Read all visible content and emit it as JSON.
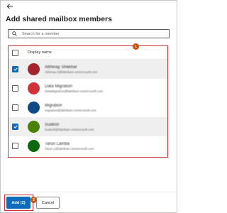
{
  "dialog": {
    "title": "Add shared mailbox members"
  },
  "search": {
    "placeholder": "Search for a member",
    "value": ""
  },
  "list": {
    "header_label": "Display name",
    "members": [
      {
        "name": "Abhinay Shekhar",
        "email": "Abhinay.S@fabrikam.onmicrosoft.com",
        "selected": true,
        "avatar_color": "#a4262c"
      },
      {
        "name": "Data Migration",
        "email": "DataMigration@fabrikam.onmicrosoft.com",
        "selected": false,
        "avatar_color": "#d13438"
      },
      {
        "name": "Migration",
        "email": "migration@fabrikam.onmicrosoft.com",
        "selected": false,
        "avatar_color": "#0f4a85"
      },
      {
        "name": "Sudesh",
        "email": "Sudesh@fabrikam.onmicrosoft.com",
        "selected": true,
        "avatar_color": "#498205"
      },
      {
        "name": "Tarun Lamba",
        "email": "Tarun.L@fabrikam.onmicrosoft.com",
        "selected": false,
        "avatar_color": "#0b6a0b"
      }
    ]
  },
  "callouts": {
    "list": "1",
    "add": "2"
  },
  "footer": {
    "add_label": "Add (2)",
    "cancel_label": "Cancel"
  },
  "colors": {
    "accent": "#0f6cbd",
    "highlight_border": "#d13438",
    "callout": "#ca5010"
  }
}
